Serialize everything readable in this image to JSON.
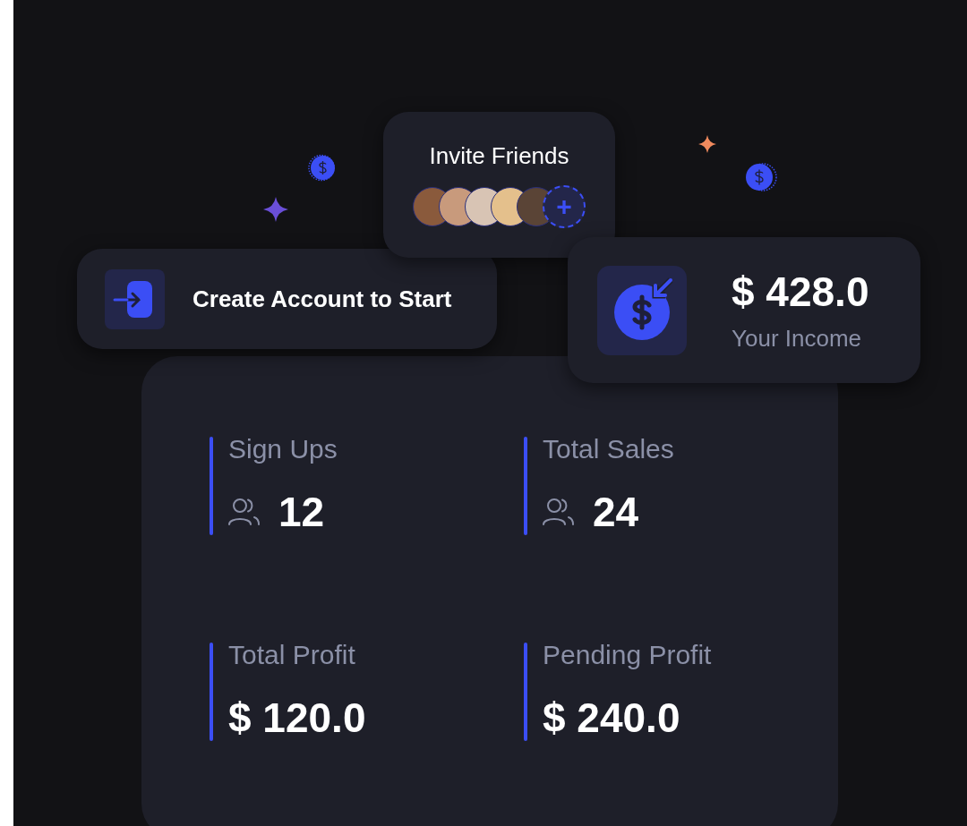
{
  "invite": {
    "title": "Invite Friends",
    "avatars": [
      {
        "kind": "photo"
      },
      {
        "kind": "photo"
      },
      {
        "kind": "photo"
      },
      {
        "kind": "photo"
      },
      {
        "kind": "photo"
      }
    ],
    "add_label": "+"
  },
  "create_account": {
    "label": "Create Account to Start"
  },
  "income": {
    "amount": "$ 428.0",
    "label": "Your Income"
  },
  "stats": [
    {
      "kind": "count",
      "label": "Sign Ups",
      "value": "12"
    },
    {
      "kind": "count",
      "label": "Total Sales",
      "value": "24"
    },
    {
      "kind": "money",
      "label": "Total Profit",
      "value": "$ 120.0"
    },
    {
      "kind": "money",
      "label": "Pending Profit",
      "value": "$ 240.0"
    }
  ]
}
